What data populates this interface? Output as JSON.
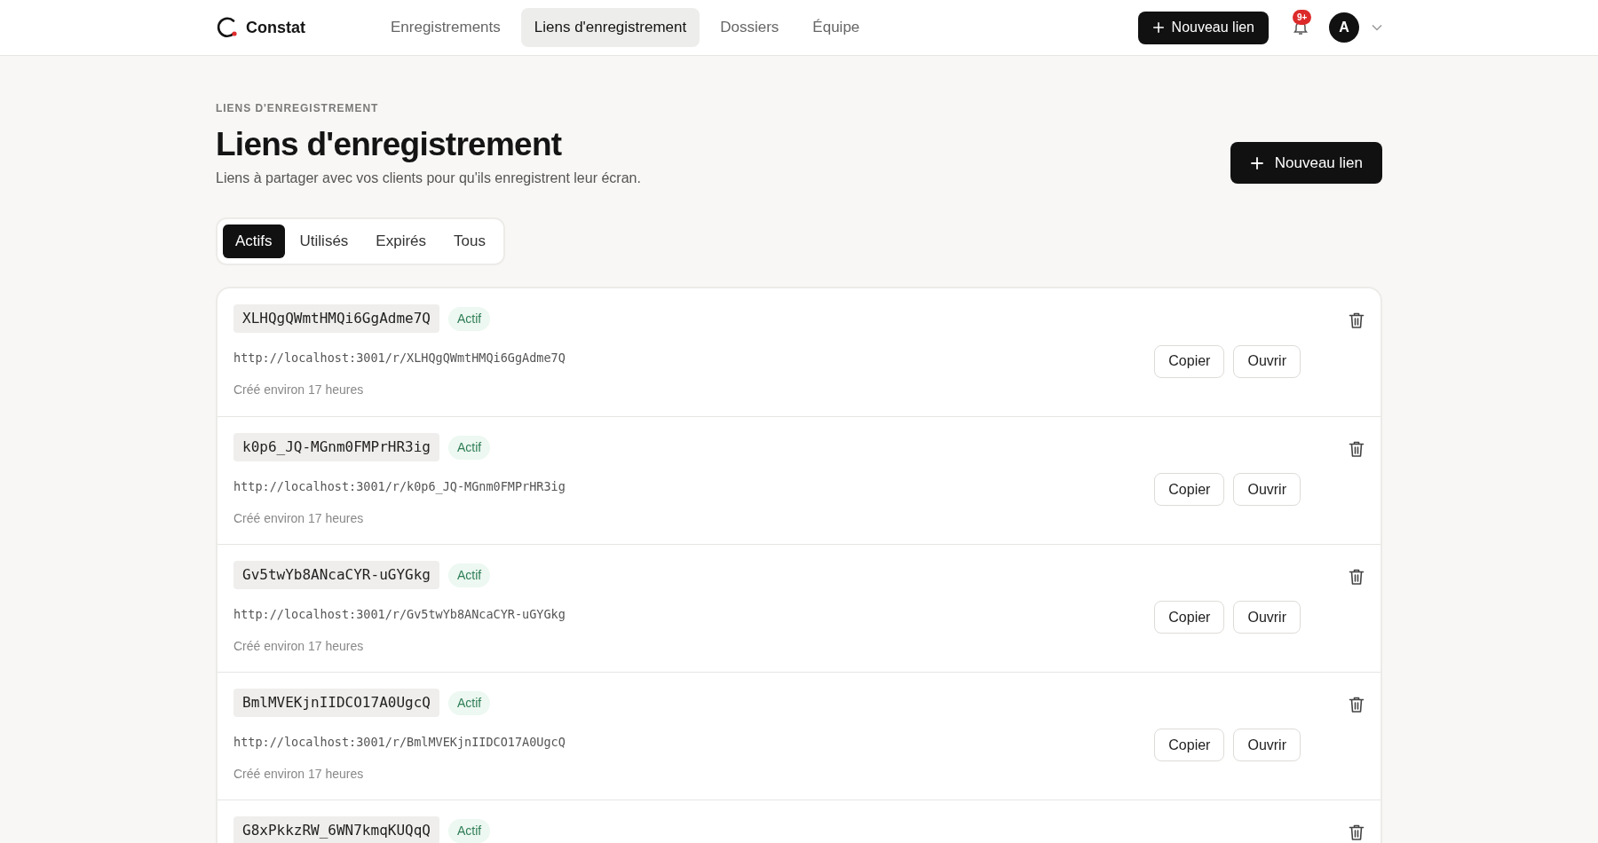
{
  "brand": {
    "name": "Constat"
  },
  "nav": [
    {
      "label": "Enregistrements",
      "selected": false
    },
    {
      "label": "Liens d'enregistrement",
      "selected": true
    },
    {
      "label": "Dossiers",
      "selected": false
    },
    {
      "label": "Équipe",
      "selected": false
    }
  ],
  "header_actions": {
    "new_button": "Nouveau lien",
    "notification_badge": "9+",
    "avatar": "A"
  },
  "page": {
    "breadcrumb": "LIENS D'ENREGISTREMENT",
    "title": "Liens d'enregistrement",
    "subtitle": "Liens à partager avec vos clients pour qu'ils enregistrent leur écran.",
    "new_button": "Nouveau lien"
  },
  "filters": [
    {
      "label": "Actifs",
      "selected": true
    },
    {
      "label": "Utilisés",
      "selected": false
    },
    {
      "label": "Expirés",
      "selected": false
    },
    {
      "label": "Tous",
      "selected": false
    }
  ],
  "links": [
    {
      "code": "XLHQgQWmtHMQi6GgAdme7Q",
      "status": "Actif",
      "kind": "active",
      "url": "http://localhost:3001/r/XLHQgQWmtHMQi6GgAdme7Q",
      "created": "Créé environ 17 heures",
      "buttons": [
        "Copier",
        "Ouvrir"
      ]
    },
    {
      "code": "k0p6_JQ-MGnm0FMPrHR3ig",
      "status": "Actif",
      "kind": "active",
      "url": "http://localhost:3001/r/k0p6_JQ-MGnm0FMPrHR3ig",
      "created": "Créé environ 17 heures",
      "buttons": [
        "Copier",
        "Ouvrir"
      ]
    },
    {
      "code": "Gv5twYb8ANcaCYR-uGYGkg",
      "status": "Actif",
      "kind": "active",
      "url": "http://localhost:3001/r/Gv5twYb8ANcaCYR-uGYGkg",
      "created": "Créé environ 17 heures",
      "buttons": [
        "Copier",
        "Ouvrir"
      ]
    },
    {
      "code": "BmlMVEKjnIIDCO17A0UgcQ",
      "status": "Actif",
      "kind": "active",
      "url": "http://localhost:3001/r/BmlMVEKjnIIDCO17A0UgcQ",
      "created": "Créé environ 17 heures",
      "buttons": [
        "Copier",
        "Ouvrir"
      ]
    },
    {
      "code": "G8xPkkzRW_6WN7kmqKUQqQ",
      "status": "Actif",
      "kind": "active"
    }
  ]
}
